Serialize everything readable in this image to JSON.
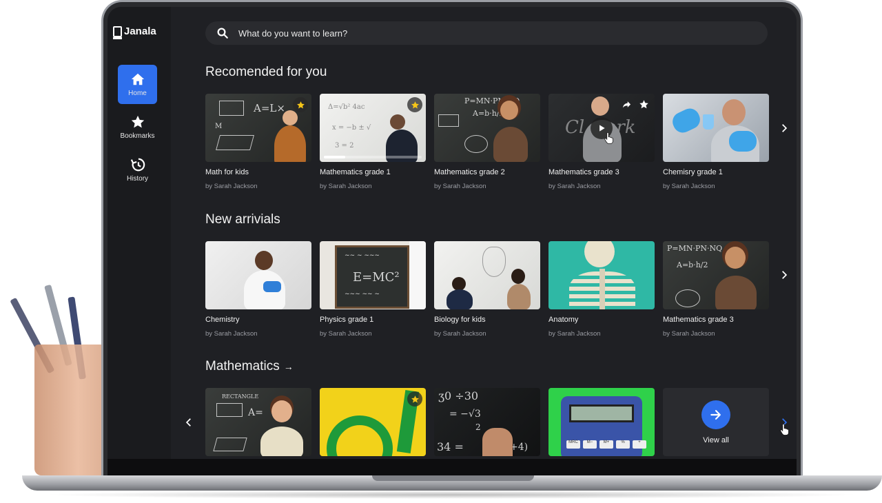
{
  "app": {
    "name": "Janala"
  },
  "sidebar": {
    "items": [
      {
        "label": "Home",
        "icon": "home-icon",
        "active": true
      },
      {
        "label": "Bookmarks",
        "icon": "star-icon",
        "active": false
      },
      {
        "label": "History",
        "icon": "history-icon",
        "active": false
      }
    ]
  },
  "search": {
    "placeholder": "What do you want to learn?"
  },
  "sections": {
    "recommended": {
      "title": "Recomended for you",
      "cards": [
        {
          "title": "Math for kids",
          "author": "by Sarah Jackson",
          "bookmarked": true
        },
        {
          "title": "Mathematics grade 1",
          "author": "by Sarah Jackson",
          "bookmarked": true,
          "progress": 0.22
        },
        {
          "title": "Mathematics grade 2",
          "author": "by Sarah Jackson"
        },
        {
          "title": "Mathematics grade 3",
          "author": "by Sarah Jackson",
          "hovered": true
        },
        {
          "title": "Chemisry grade 1",
          "author": "by Sarah Jackson"
        }
      ]
    },
    "new_arrivals": {
      "title": "New arrivials",
      "cards": [
        {
          "title": "Chemistry",
          "author": "by Sarah Jackson"
        },
        {
          "title": "Physics grade 1",
          "author": "by Sarah Jackson"
        },
        {
          "title": "Biology for kids",
          "author": "by Sarah Jackson"
        },
        {
          "title": "Anatomy",
          "author": "by Sarah Jackson"
        },
        {
          "title": "Mathematics grade 3",
          "author": "by Sarah Jackson"
        }
      ]
    },
    "mathematics": {
      "title": "Mathematics",
      "title_arrow": "→",
      "view_all_label": "View all"
    }
  },
  "colors": {
    "accent": "#2f6fed",
    "background": "#1f2024",
    "sidebar": "#1a1b1e",
    "star": "#f5c518"
  }
}
